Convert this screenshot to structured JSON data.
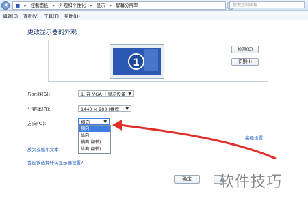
{
  "address_bar": {
    "segments": [
      "控制面板",
      "外观和个性化",
      "显示",
      "屏幕分辨率"
    ],
    "search_placeholder": "搜索控制面板"
  },
  "menu": {
    "items": [
      "编辑(E)",
      "查看(V)",
      "工具(T)",
      "帮助(H)"
    ]
  },
  "page": {
    "title": "更改显示器的外观",
    "monitor_number": "1",
    "detect_button": "检测(C)",
    "identify_button": "识别(I)",
    "display_label": "显示器(S):",
    "display_value": "1. 在 VGA 上显示设备",
    "resolution_label": "分辨率(R):",
    "resolution_value": "1440 × 900 (推荐)",
    "orientation_label": "方向(O):",
    "orientation_value": "横向",
    "orientation_options": [
      "横向",
      "纵向",
      "横向(翻转)",
      "纵向(翻转)"
    ],
    "advanced_link": "高级设置",
    "text_size_link": "放大或缩小文本",
    "help_link": "我应该选择什么显示器设置?",
    "ok_button": "确定"
  },
  "watermark": "软件技巧",
  "colors": {
    "accent": "#3d7ee0",
    "link": "#1a5bbf",
    "arrow": "#e0302a"
  }
}
